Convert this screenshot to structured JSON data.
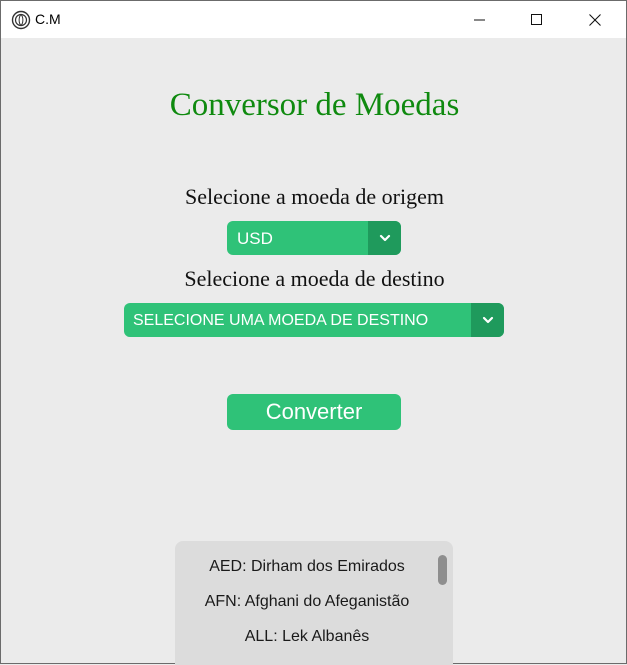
{
  "window": {
    "title": "C.M"
  },
  "main": {
    "title": "Conversor de Moedas",
    "origin_label": "Selecione a moeda de origem",
    "origin_value": "USD",
    "destination_label": "Selecione a moeda de destino",
    "destination_value": "SELECIONE UMA MOEDA DE DESTINO",
    "convert_label": "Converter"
  },
  "currency_list": {
    "items": [
      {
        "label": "AED: Dirham dos Emirados"
      },
      {
        "label": "AFN: Afghani do Afeganistão"
      },
      {
        "label": "ALL: Lek Albanês"
      }
    ]
  },
  "colors": {
    "title": "#0f8a0f",
    "accent": "#2fc278",
    "accent_dark": "#1f9a5c",
    "background": "#ebebeb",
    "list_background": "#dcdcdc"
  }
}
